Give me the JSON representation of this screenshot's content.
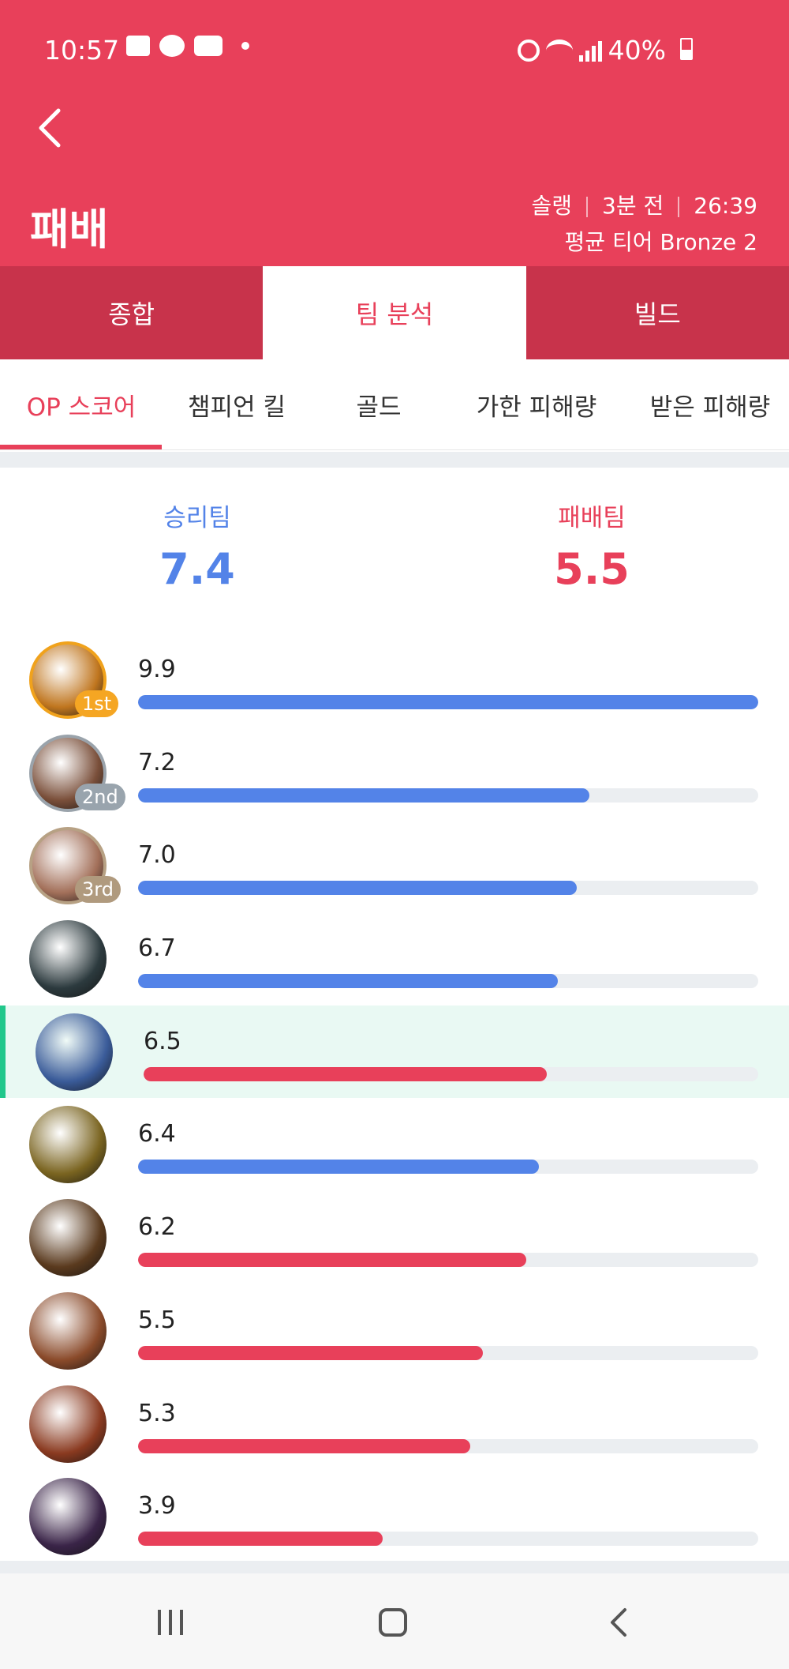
{
  "status_bar": {
    "time": "10:57",
    "battery": "40%",
    "icons": [
      "gallery-icon",
      "talk-icon",
      "youtube-icon",
      "dot-icon",
      "alarm-icon",
      "wifi-icon",
      "signal-icon",
      "battery-icon"
    ]
  },
  "header": {
    "title": "패배",
    "queue": "솔랭",
    "time_ago": "3분 전",
    "duration": "26:39",
    "avg_tier": "평균 티어 Bronze 2",
    "bg_color": "#e8405a"
  },
  "main_tabs": [
    {
      "label": "종합"
    },
    {
      "label": "팀 분석"
    },
    {
      "label": "빌드"
    }
  ],
  "sub_tabs": [
    {
      "label": "OP 스코어"
    },
    {
      "label": "챔피언 킬"
    },
    {
      "label": "골드"
    },
    {
      "label": "가한 피해량"
    },
    {
      "label": "받은 피해량"
    }
  ],
  "teams": {
    "win": {
      "label": "승리팀",
      "score": "7.4",
      "color": "#5383e8"
    },
    "lose": {
      "label": "패배팀",
      "score": "5.5",
      "color": "#e8405a"
    }
  },
  "players": [
    {
      "score": "9.9",
      "value": 9.9,
      "team": "win",
      "rank": "1st",
      "rank_color": "#f5a623",
      "avatar": "#c0761f",
      "ring": "#f0a21c"
    },
    {
      "score": "7.2",
      "value": 7.2,
      "team": "win",
      "rank": "2nd",
      "rank_color": "#99a4ad",
      "avatar": "#7a4f3a",
      "ring": "#9aa3ab"
    },
    {
      "score": "7.0",
      "value": 7.0,
      "team": "win",
      "rank": "3rd",
      "rank_color": "#b09a7e",
      "avatar": "#a3705a",
      "ring": "#b7a184"
    },
    {
      "score": "6.7",
      "value": 6.7,
      "team": "win",
      "rank": "",
      "avatar": "#2c3a3e"
    },
    {
      "score": "6.5",
      "value": 6.5,
      "team": "lose",
      "rank": "",
      "avatar": "#3a5b99",
      "me": true
    },
    {
      "score": "6.4",
      "value": 6.4,
      "team": "win",
      "rank": "",
      "avatar": "#7a6420"
    },
    {
      "score": "6.2",
      "value": 6.2,
      "team": "lose",
      "rank": "",
      "avatar": "#5a3a1e"
    },
    {
      "score": "5.5",
      "value": 5.5,
      "team": "lose",
      "rank": "",
      "avatar": "#8a4a2a"
    },
    {
      "score": "5.3",
      "value": 5.3,
      "team": "lose",
      "rank": "",
      "avatar": "#8a3a20"
    },
    {
      "score": "3.9",
      "value": 3.9,
      "team": "lose",
      "rank": "",
      "avatar": "#3a2448"
    }
  ],
  "max_score": 9.9
}
